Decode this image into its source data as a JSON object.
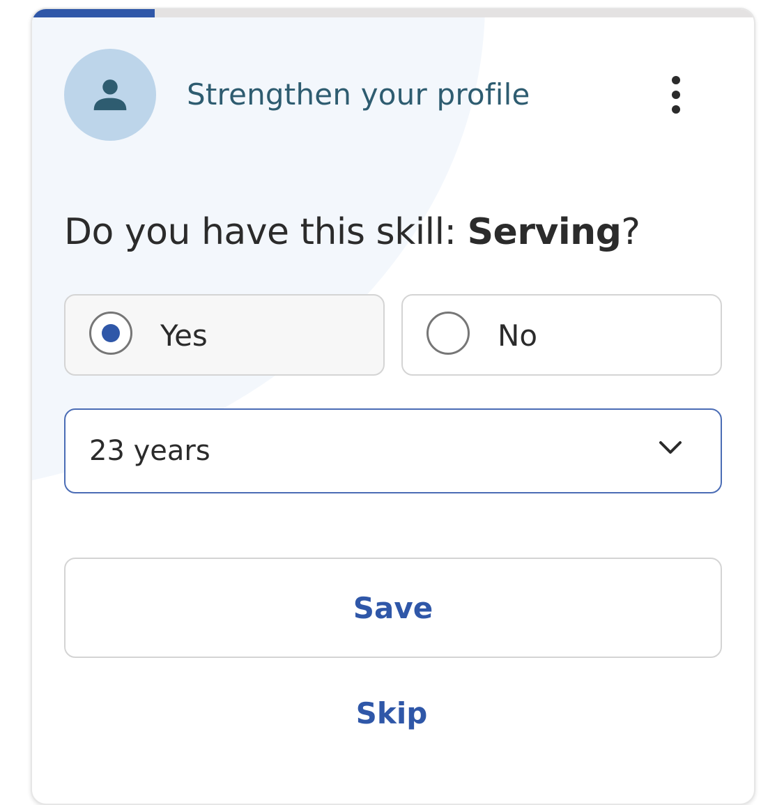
{
  "progress": {
    "percent": 17,
    "fill_color": "#2f57a8"
  },
  "header": {
    "avatar_icon": "person-icon",
    "title": "Strengthen your profile",
    "more_icon": "more-vertical-icon"
  },
  "question": {
    "prefix": "Do you have this skill: ",
    "skill": "Serving",
    "suffix": "?"
  },
  "options": [
    {
      "label": "Yes",
      "selected": true
    },
    {
      "label": "No",
      "selected": false
    }
  ],
  "experience": {
    "value": "23 years",
    "icon": "chevron-down-icon"
  },
  "actions": {
    "save_label": "Save",
    "skip_label": "Skip"
  },
  "colors": {
    "accent": "#2f57a8",
    "title_text": "#2e5c70",
    "avatar_bg": "#bdd5ea"
  }
}
